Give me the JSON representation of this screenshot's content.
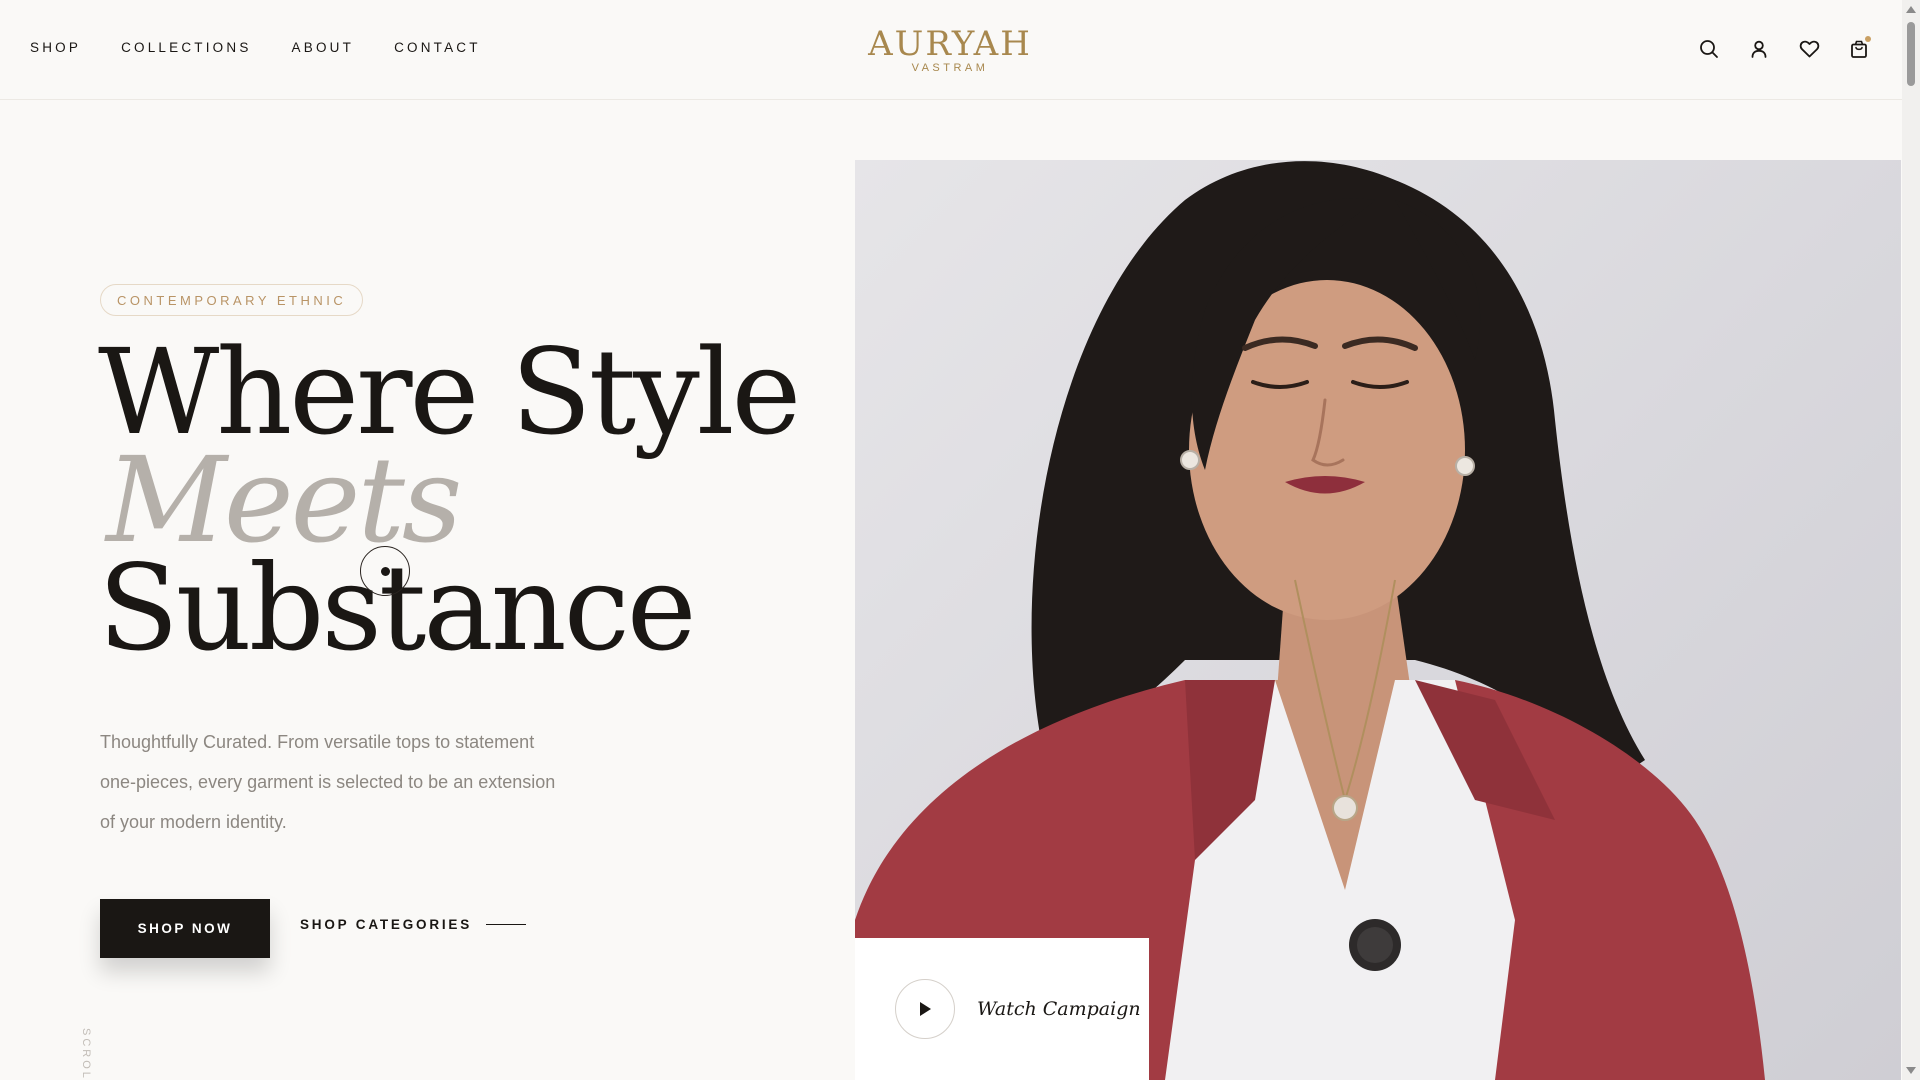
{
  "nav": {
    "items": [
      "SHOP",
      "COLLECTIONS",
      "ABOUT",
      "CONTACT"
    ]
  },
  "brand": {
    "name": "AURYAH",
    "subtitle": "VASTRAM",
    "color": "#a8884e"
  },
  "header_icons": [
    "search-icon",
    "account-icon",
    "wishlist-heart-icon",
    "shopping-bag-icon"
  ],
  "hero": {
    "tag": "CONTEMPORARY ETHNIC",
    "headline": {
      "line1": "Where Style",
      "line2": "Meets",
      "line3": "Substance"
    },
    "description": {
      "line1": "Thoughtfully Curated. From versatile tops to statement",
      "line2": "one-pieces, every garment is selected to be an extension",
      "line3": "of your modern identity."
    },
    "primary_cta": "SHOP NOW",
    "secondary_cta": "SHOP CATEGORIES",
    "scroll_hint": "SCROLL",
    "campaign_label": "Watch Campaign"
  },
  "colors": {
    "background": "#faf9f7",
    "text_dark": "#1a1714",
    "muted_italic": "#b5b0aa",
    "accent_gold": "#c9a063",
    "blazer_red": "#a23b43"
  }
}
